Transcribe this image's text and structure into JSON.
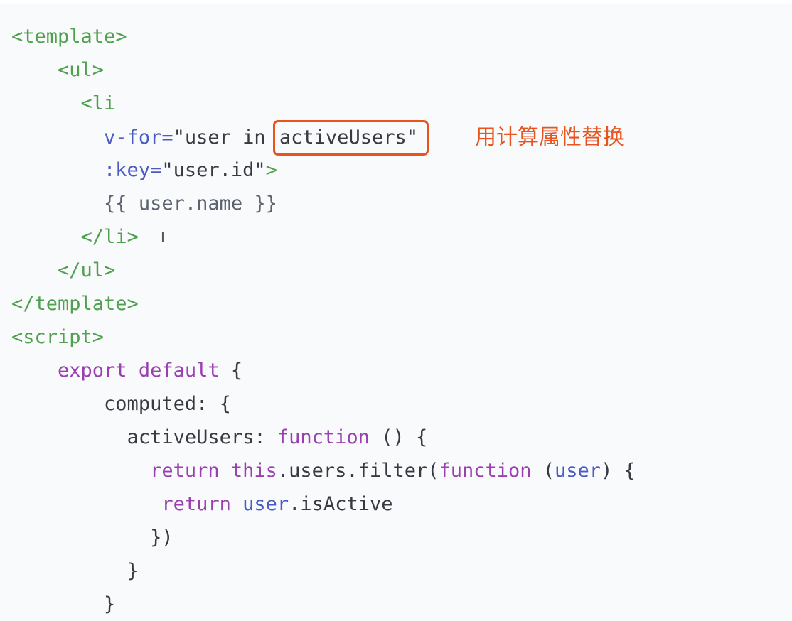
{
  "code": {
    "lines": [
      "<template>",
      "    <ul>",
      "      <li",
      "        v-for=\"user in activeUsers\"",
      "        :key=\"user.id\">",
      "        {{ user.name }}",
      "      </li>",
      "    </ul>",
      "</template>",
      "<script>",
      "    export default {",
      "        computed: {",
      "          activeUsers: function () {",
      "            return this.users.filter(function (user) {",
      "             return user.isActive",
      "            })",
      "          }",
      "        }"
    ],
    "highlight_text": "activeUsers\"",
    "annotation": "用计算属性替换"
  },
  "colors": {
    "tag": "#50a14f",
    "attribute": "#4a5bc4",
    "keyword": "#9a3fb0",
    "highlight_box": "#e8531e"
  },
  "cursor_icon": "text-cursor-icon"
}
